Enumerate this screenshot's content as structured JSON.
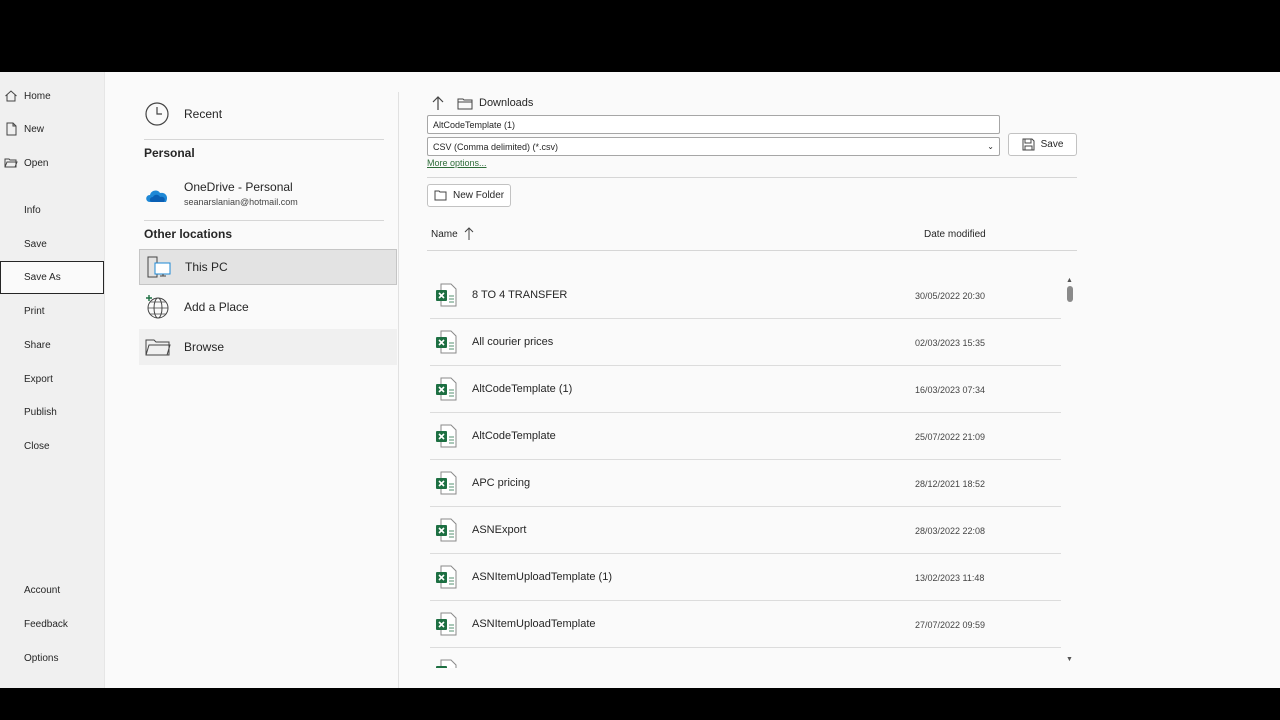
{
  "nav": {
    "items": [
      {
        "label": "Home",
        "icon": "home-icon"
      },
      {
        "label": "New",
        "icon": "new-doc-icon"
      },
      {
        "label": "Open",
        "icon": "folder-open-icon"
      },
      {
        "label": "Info"
      },
      {
        "label": "Save"
      },
      {
        "label": "Save As"
      },
      {
        "label": "Print"
      },
      {
        "label": "Share"
      },
      {
        "label": "Export"
      },
      {
        "label": "Publish"
      },
      {
        "label": "Close"
      }
    ],
    "bottom": [
      {
        "label": "Account"
      },
      {
        "label": "Feedback"
      },
      {
        "label": "Options"
      }
    ]
  },
  "locations": {
    "recent": "Recent",
    "personal_header": "Personal",
    "onedrive_title": "OneDrive - Personal",
    "onedrive_email": "seanarslanian@hotmail.com",
    "other_header": "Other locations",
    "this_pc": "This PC",
    "add_place": "Add a Place",
    "browse": "Browse"
  },
  "saveas": {
    "path_folder": "Downloads",
    "file_name": "AltCodeTemplate (1)",
    "file_type": "CSV (Comma delimited) (*.csv)",
    "more_options": "More options...",
    "save_label": "Save",
    "new_folder_label": "New Folder",
    "col_name": "Name",
    "col_date": "Date modified"
  },
  "files": [
    {
      "name": "8 TO 4 TRANSFER",
      "date": "30/05/2022 20:30"
    },
    {
      "name": "All courier prices",
      "date": "02/03/2023 15:35"
    },
    {
      "name": "AltCodeTemplate (1)",
      "date": "16/03/2023 07:34"
    },
    {
      "name": "AltCodeTemplate",
      "date": "25/07/2022 21:09"
    },
    {
      "name": "APC pricing",
      "date": "28/12/2021 18:52"
    },
    {
      "name": "ASNExport",
      "date": "28/03/2022 22:08"
    },
    {
      "name": "ASNItemUploadTemplate (1)",
      "date": "13/02/2023 11:48"
    },
    {
      "name": "ASNItemUploadTemplate",
      "date": "27/07/2022 09:59"
    },
    {
      "name": "",
      "date": ""
    }
  ],
  "colors": {
    "excel_green": "#1d6f42",
    "link_green": "#2e6d39",
    "onedrive_blue": "#1e88d6"
  }
}
